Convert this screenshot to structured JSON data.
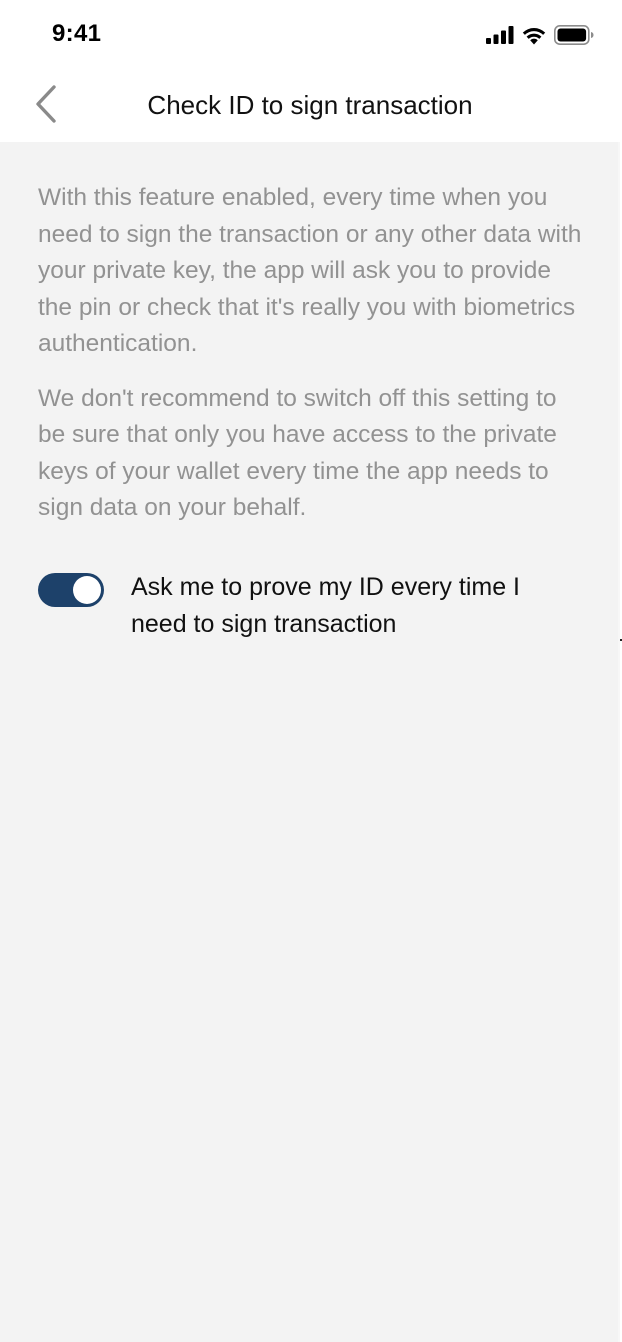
{
  "status_bar": {
    "time": "9:41",
    "icons": [
      "cellular-signal-icon",
      "wifi-icon",
      "battery-icon"
    ]
  },
  "nav": {
    "back_icon": "chevron-left-icon",
    "title": "Check ID to sign transaction"
  },
  "content": {
    "paragraph_1": "With this feature enabled, every time when you need to sign the transaction or any other data with your private key, the app will ask you to provide the pin or check that it's really you with biometrics authentication.",
    "paragraph_2": "We don't recommend to switch off this setting to be sure that only you have access to the private keys of your wallet every time the app needs to sign data on your behalf."
  },
  "setting": {
    "label": "Ask me to prove my ID every time I need to sign transaction",
    "enabled": true
  },
  "colors": {
    "background": "#f3f3f3",
    "header": "#ffffff",
    "toggle_on": "#1d416a",
    "body_text": "#929292",
    "primary_text": "#111111"
  }
}
